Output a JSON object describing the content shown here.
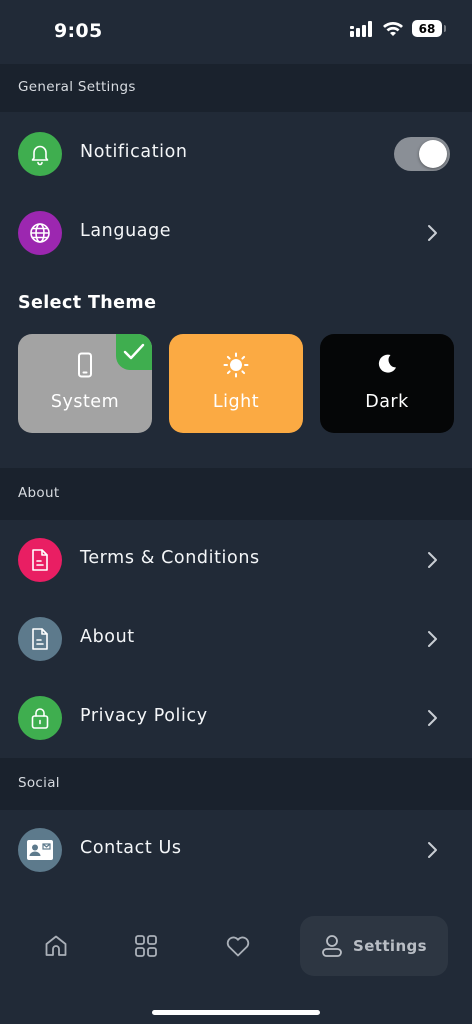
{
  "status_bar": {
    "time": "9:05",
    "battery": "68"
  },
  "sections": {
    "general": {
      "title": "General Settings"
    },
    "about": {
      "title": "About"
    },
    "social": {
      "title": "Social"
    }
  },
  "general": {
    "notification": {
      "label": "Notification",
      "enabled": true,
      "icon": "bell-icon",
      "color": "#3fae4f"
    },
    "language": {
      "label": "Language",
      "icon": "globe-icon",
      "color": "#9c27b0"
    }
  },
  "theme": {
    "title": "Select Theme",
    "selected": "System",
    "options": [
      {
        "label": "System",
        "icon": "phone-icon",
        "bg": "#a3a3a3"
      },
      {
        "label": "Light",
        "icon": "sun-icon",
        "bg": "#fbaa43"
      },
      {
        "label": "Dark",
        "icon": "moon-icon",
        "bg": "#050607"
      }
    ]
  },
  "about": {
    "terms": {
      "label": "Terms & Conditions",
      "icon": "document-icon",
      "color": "#e91e63"
    },
    "about": {
      "label": "About",
      "icon": "document-icon",
      "color": "#5d7a8c"
    },
    "privacy": {
      "label": "Privacy Policy",
      "icon": "lock-icon",
      "color": "#3fae4f"
    }
  },
  "social": {
    "contact": {
      "label": "Contact Us",
      "icon": "contact-card-icon",
      "color": "#5d7a8c"
    }
  },
  "tabbar": {
    "tabs": [
      {
        "icon": "home-icon"
      },
      {
        "icon": "grid-icon"
      },
      {
        "icon": "heart-icon"
      },
      {
        "icon": "person-icon",
        "label": "Settings",
        "active": true
      }
    ]
  }
}
